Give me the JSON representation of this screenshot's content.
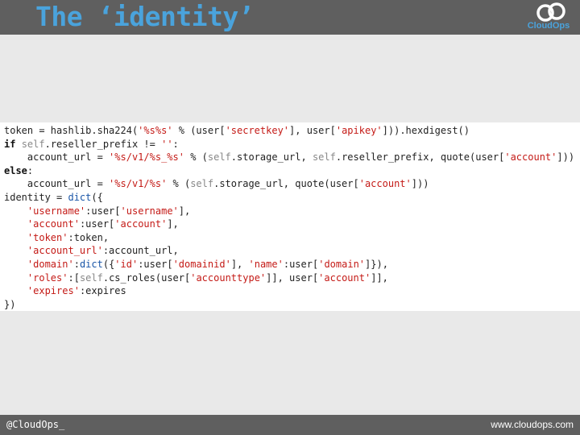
{
  "slide": {
    "title": "The ‘identity’",
    "logo_text": "CloudOps"
  },
  "code": {
    "lines": [
      [
        [
          "t",
          "token = hashlib.sha224("
        ],
        [
          "s",
          "'%s%s'"
        ],
        [
          "t",
          " % (user["
        ],
        [
          "s",
          "'secretkey'"
        ],
        [
          "t",
          "], user["
        ],
        [
          "s",
          "'apikey'"
        ],
        [
          "t",
          "])).hexdigest()"
        ]
      ],
      [
        [
          "k",
          "if "
        ],
        [
          "f",
          "self"
        ],
        [
          "t",
          ".reseller_prefix != "
        ],
        [
          "s",
          "''"
        ],
        [
          "t",
          ":"
        ]
      ],
      [
        [
          "t",
          "    account_url = "
        ],
        [
          "s",
          "'%s/v1/%s_%s'"
        ],
        [
          "t",
          " % ("
        ],
        [
          "f",
          "self"
        ],
        [
          "t",
          ".storage_url, "
        ],
        [
          "f",
          "self"
        ],
        [
          "t",
          ".reseller_prefix, quote(user["
        ],
        [
          "s",
          "'account'"
        ],
        [
          "t",
          "]))"
        ]
      ],
      [
        [
          "k",
          "else"
        ],
        [
          "t",
          ":"
        ]
      ],
      [
        [
          "t",
          "    account_url = "
        ],
        [
          "s",
          "'%s/v1/%s'"
        ],
        [
          "t",
          " % ("
        ],
        [
          "f",
          "self"
        ],
        [
          "t",
          ".storage_url, quote(user["
        ],
        [
          "s",
          "'account'"
        ],
        [
          "t",
          "]))"
        ]
      ],
      [
        [
          "t",
          "identity = "
        ],
        [
          "b",
          "dict"
        ],
        [
          "t",
          "({"
        ]
      ],
      [
        [
          "t",
          "    "
        ],
        [
          "s",
          "'username'"
        ],
        [
          "t",
          ":user["
        ],
        [
          "s",
          "'username'"
        ],
        [
          "t",
          "],"
        ]
      ],
      [
        [
          "t",
          "    "
        ],
        [
          "s",
          "'account'"
        ],
        [
          "t",
          ":user["
        ],
        [
          "s",
          "'account'"
        ],
        [
          "t",
          "],"
        ]
      ],
      [
        [
          "t",
          "    "
        ],
        [
          "s",
          "'token'"
        ],
        [
          "t",
          ":token,"
        ]
      ],
      [
        [
          "t",
          "    "
        ],
        [
          "s",
          "'account_url'"
        ],
        [
          "t",
          ":account_url,"
        ]
      ],
      [
        [
          "t",
          "    "
        ],
        [
          "s",
          "'domain'"
        ],
        [
          "t",
          ":"
        ],
        [
          "b",
          "dict"
        ],
        [
          "t",
          "({"
        ],
        [
          "s",
          "'id'"
        ],
        [
          "t",
          ":user["
        ],
        [
          "s",
          "'domainid'"
        ],
        [
          "t",
          "], "
        ],
        [
          "s",
          "'name'"
        ],
        [
          "t",
          ":user["
        ],
        [
          "s",
          "'domain'"
        ],
        [
          "t",
          "]}),"
        ]
      ],
      [
        [
          "t",
          "    "
        ],
        [
          "s",
          "'roles'"
        ],
        [
          "t",
          ":["
        ],
        [
          "f",
          "self"
        ],
        [
          "t",
          ".cs_roles(user["
        ],
        [
          "s",
          "'accounttype'"
        ],
        [
          "t",
          "]], user["
        ],
        [
          "s",
          "'account'"
        ],
        [
          "t",
          "]],"
        ]
      ],
      [
        [
          "t",
          "    "
        ],
        [
          "s",
          "'expires'"
        ],
        [
          "t",
          ":expires"
        ]
      ],
      [
        [
          "t",
          "})"
        ]
      ]
    ]
  },
  "footer": {
    "left": "@CloudOps_",
    "right": "www.cloudops.com"
  },
  "colors": {
    "bar": "#5f5f5f",
    "title": "#4aa3dc",
    "string": "#c41a16",
    "builtin": "#1a56a8"
  }
}
